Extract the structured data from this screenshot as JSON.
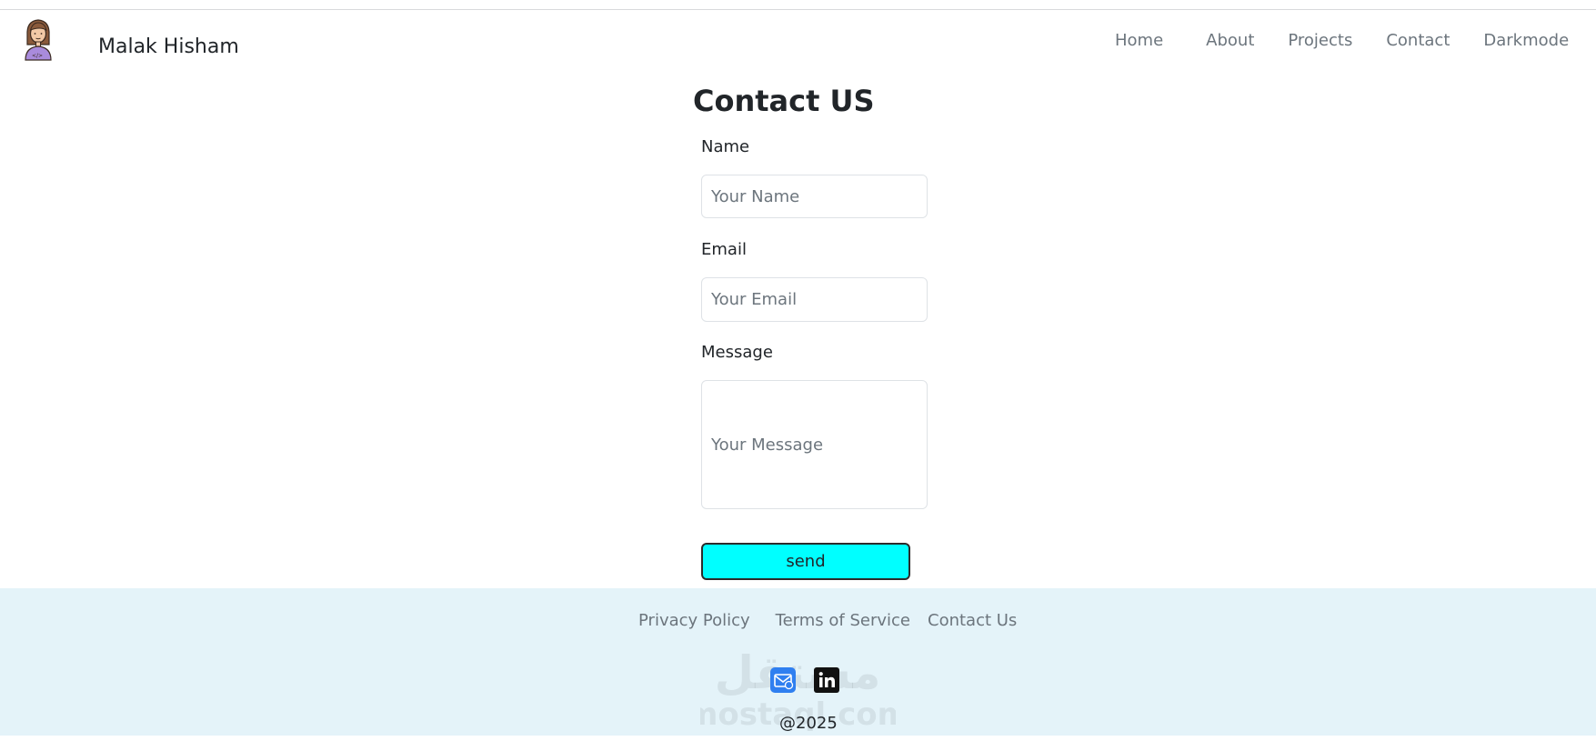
{
  "navbar": {
    "brand_name": "Malak Hisham",
    "links": [
      "Home",
      "About",
      "Projects",
      "Contact",
      "Darkmode"
    ]
  },
  "form": {
    "title": "Contact US",
    "name_label": "Name",
    "name_placeholder": "Your Name",
    "email_label": "Email",
    "email_placeholder": "Your Email",
    "message_label": "Message",
    "message_placeholder": "Your Message",
    "send_label": "send",
    "send_color": "#00ffff"
  },
  "footer": {
    "links": [
      "Privacy Policy",
      "Terms of Service",
      "Contact Us"
    ],
    "social_icons": [
      "email-icon",
      "linkedin-icon"
    ],
    "copyright": "@2025",
    "background": "#e4f3f9",
    "watermark_text": "مستقل mostaql.com"
  }
}
